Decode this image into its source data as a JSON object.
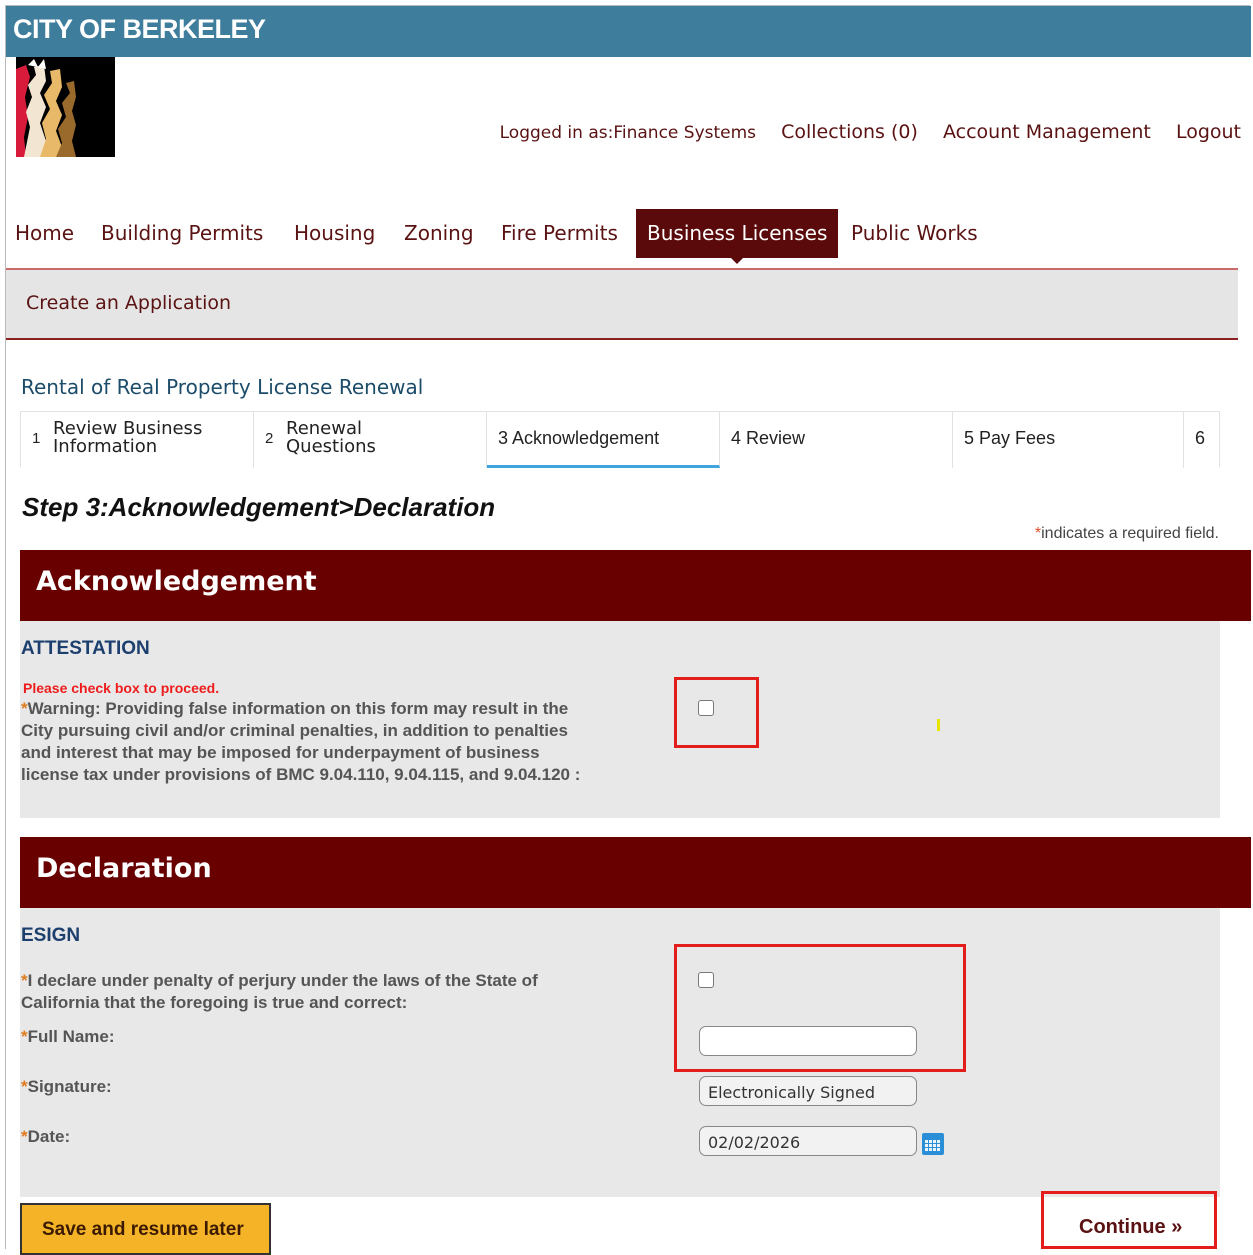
{
  "header": {
    "site_title": "CITY OF BERKELEY"
  },
  "user_links": {
    "logged_in": "Logged in as:Finance Systems",
    "collections": "Collections (0)",
    "account": "Account Management",
    "logout": "Logout"
  },
  "nav": {
    "home": "Home",
    "building_permits": "Building Permits",
    "housing": "Housing",
    "zoning": "Zoning",
    "fire_permits": "Fire Permits",
    "business_licenses": "Business Licenses",
    "public_works": "Public Works"
  },
  "subbar": {
    "title": "Create an Application"
  },
  "application": {
    "title": "Rental of Real Property License Renewal"
  },
  "steps": {
    "s1": {
      "num": "1",
      "label_line1": "Review Business",
      "label_line2": "Information"
    },
    "s2": {
      "num": "2",
      "label_line1": "Renewal",
      "label_line2": "Questions"
    },
    "s3": {
      "num": "3",
      "label": "Acknowledgement"
    },
    "s4": {
      "num": "4",
      "label": "Review"
    },
    "s5": {
      "num": "5",
      "label": "Pay Fees"
    },
    "s6": {
      "num": "6"
    }
  },
  "step_heading": "Step 3:Acknowledgement>Declaration",
  "required_note": {
    "star": "*",
    "text": "indicates a required field."
  },
  "acknowledgement": {
    "band_title": "Acknowledgement",
    "section_label": "ATTESTATION",
    "error": "Please check box to proceed.",
    "star": "*",
    "warning_line1": "Warning: Providing false information on this form may result in the",
    "warning_line2": "City pursuing civil and/or criminal penalties, in addition to penalties",
    "warning_line3": "and interest that may be imposed for underpayment of business",
    "warning_line4": "license tax under provisions of BMC 9.04.110, 9.04.115, and 9.04.120 :"
  },
  "declaration": {
    "band_title": "Declaration",
    "section_label": "ESIGN",
    "star": "*",
    "declare_line1": "I declare under penalty of perjury under the laws of the State of",
    "declare_line2": "California that the foregoing is true and correct:",
    "full_name_label": "Full Name:",
    "full_name_value": "",
    "signature_label": "Signature:",
    "signature_value": "Electronically Signed",
    "date_label": "Date:",
    "date_value": "02/02/2026"
  },
  "buttons": {
    "save_resume": "Save and resume later",
    "continue": "Continue »"
  },
  "colors": {
    "header_blue": "#3e7d9c",
    "brand_maroon": "#680000",
    "error_red": "#ee1c1c",
    "button_yellow": "#f5b428"
  }
}
